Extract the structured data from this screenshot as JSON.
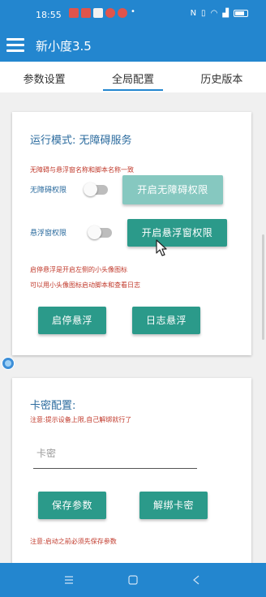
{
  "status_bar": {
    "time": "18:55"
  },
  "app": {
    "title": "新小度3.5"
  },
  "tabs": [
    {
      "label": "参数设置"
    },
    {
      "label": "全局配置"
    },
    {
      "label": "历史版本"
    }
  ],
  "card1": {
    "heading": "运行模式: 无障碍服务",
    "note_top": "无障碍与悬浮窗名称和脚本名称一致",
    "accessibility_label": "无障碍权限",
    "accessibility_button": "开启无障碍权限",
    "overlay_label": "悬浮窗权限",
    "overlay_button": "开启悬浮窗权限",
    "note_1": "启停悬浮是开启左侧的小头像图标",
    "note_2": "可以用小头像图标启动脚本和查看日志",
    "start_stop_button": "启停悬浮",
    "log_button": "日志悬浮"
  },
  "card2": {
    "heading": "卡密配置:",
    "note_top": "注意:提示设备上限,自己解绑就行了",
    "input_placeholder": "卡密",
    "input_value": "",
    "save_button": "保存参数",
    "unbind_button": "解绑卡密",
    "note_bottom": "注意:启动之前必须先保存参数"
  },
  "colors": {
    "primary": "#2386cf",
    "button": "#2b9a8a",
    "button_disabled": "#86c8c0",
    "heading": "#2b6b9e",
    "warning": "#c0392b"
  },
  "icons": {
    "menu": "hamburger-menu-icon",
    "cursor": "mouse-pointer-icon",
    "floating": "floating-globe-icon",
    "nav_menu": "nav-menu-icon",
    "nav_home": "nav-home-icon",
    "nav_back": "nav-back-icon"
  }
}
